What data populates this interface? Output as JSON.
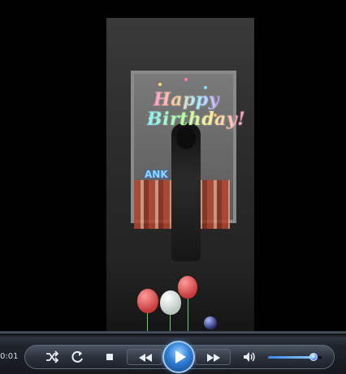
{
  "video": {
    "overlay_line1": "Happy",
    "overlay_line2": "Birthday!",
    "caption": "ANK"
  },
  "controls": {
    "current_time": "0:01",
    "volume_level": 0.85,
    "icons": {
      "shuffle": "shuffle-icon",
      "repeat": "repeat-icon",
      "stop": "stop-icon",
      "previous": "previous-icon",
      "play": "play-icon",
      "next": "next-icon",
      "volume": "volume-icon"
    }
  }
}
